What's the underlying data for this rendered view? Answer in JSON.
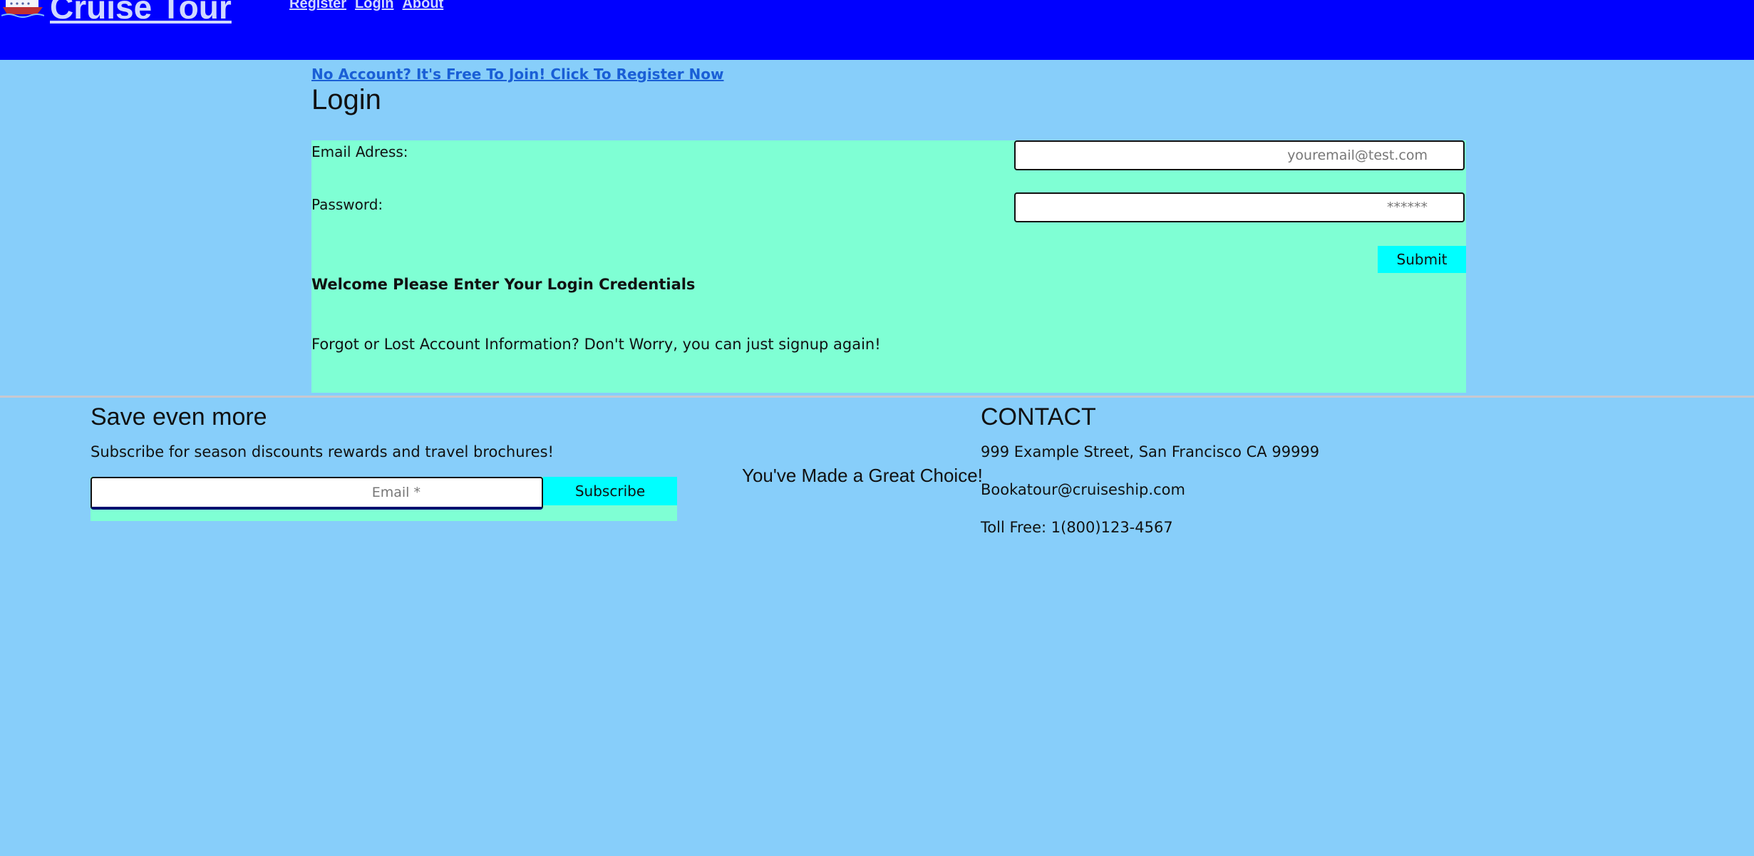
{
  "header": {
    "brand": "Cruise Tour",
    "brand_icon": "cruise-ship-icon",
    "nav": [
      "Register",
      "Login",
      "About"
    ],
    "background": "#0000ff"
  },
  "login": {
    "register_prompt": "No Account? It's Free To Join! Click To Register Now",
    "title": "Login",
    "email_label": "Email Adress:",
    "email_placeholder": "youremail@test.com",
    "password_label": "Password:",
    "password_placeholder": "******",
    "submit_label": "Submit",
    "welcome": "Welcome Please Enter Your Login Credentials",
    "forgot": "Forgot or Lost Account Information? Don't Worry, you can just signup again!",
    "panel_color": "#7fffd4"
  },
  "footer": {
    "save_title": "Save even more",
    "save_subtitle": "Subscribe for season discounts rewards and travel brochures!",
    "email_placeholder": "Email *",
    "subscribe_label": "Subscribe",
    "tagline": "You've Made a Great Choice!",
    "contact_title": "CONTACT",
    "address": "999 Example Street, San Francisco CA 99999",
    "email": "Bookatour@cruiseship.com",
    "phone": "Toll Free: 1(800)123-4567"
  },
  "colors": {
    "page_background": "#87cefa",
    "button": "#00ffff",
    "link": "#1a5fd6"
  }
}
